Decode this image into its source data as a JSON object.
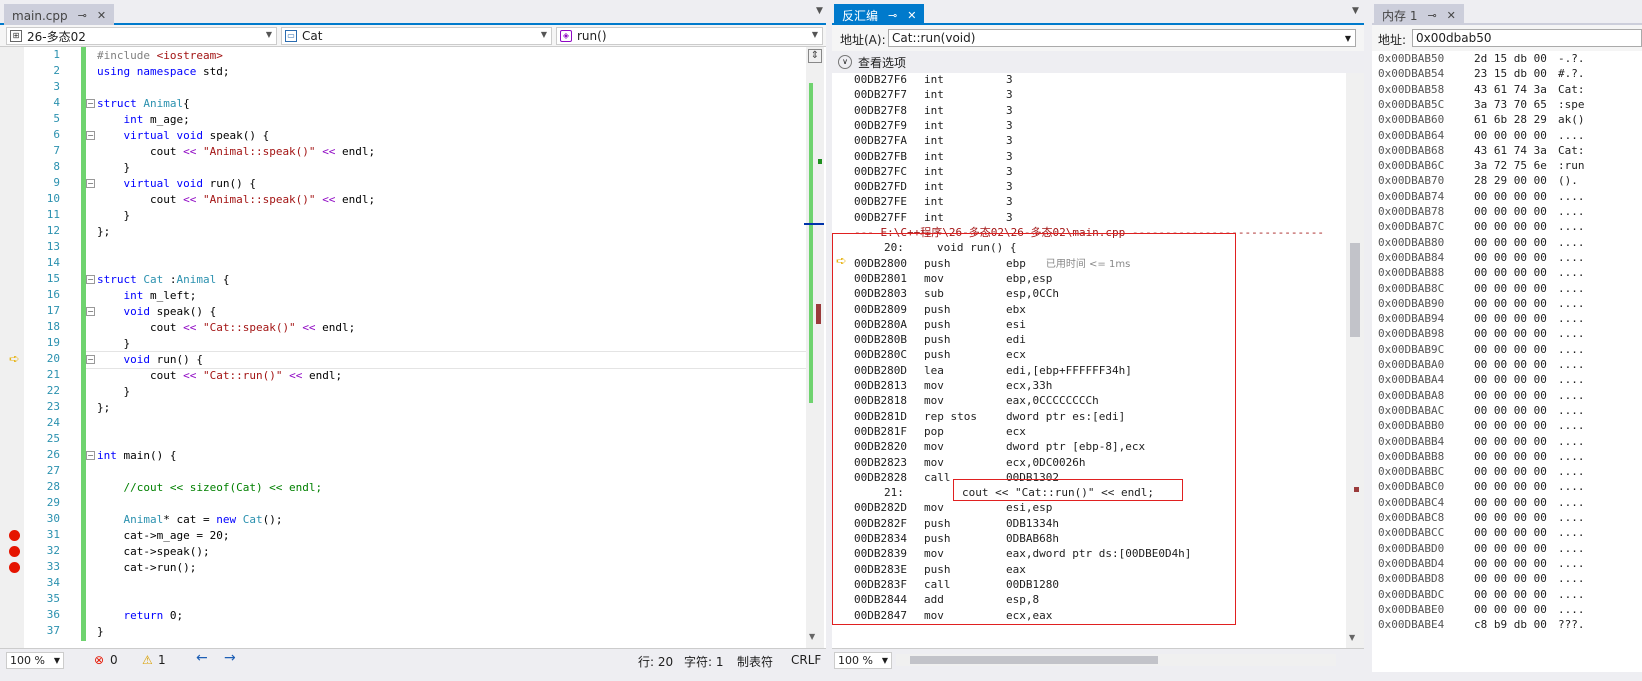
{
  "editor": {
    "tab_title": "main.cpp",
    "nav_project": "26-多态02",
    "nav_class": "Cat",
    "nav_member": "run()",
    "lines": [
      {
        "n": 1,
        "code": "#include <iostream>"
      },
      {
        "n": 2,
        "code": "using namespace std;"
      },
      {
        "n": 3,
        "code": ""
      },
      {
        "n": 4,
        "code": "struct Animal{"
      },
      {
        "n": 5,
        "code": "    int m_age;"
      },
      {
        "n": 6,
        "code": "    virtual void speak() {"
      },
      {
        "n": 7,
        "code": "        cout << \"Animal::speak()\" << endl;"
      },
      {
        "n": 8,
        "code": "    }"
      },
      {
        "n": 9,
        "code": "    virtual void run() {"
      },
      {
        "n": 10,
        "code": "        cout << \"Animal::speak()\" << endl;"
      },
      {
        "n": 11,
        "code": "    }"
      },
      {
        "n": 12,
        "code": "};"
      },
      {
        "n": 13,
        "code": ""
      },
      {
        "n": 14,
        "code": ""
      },
      {
        "n": 15,
        "code": "struct Cat :Animal {"
      },
      {
        "n": 16,
        "code": "    int m_left;"
      },
      {
        "n": 17,
        "code": "    void speak() {"
      },
      {
        "n": 18,
        "code": "        cout << \"Cat::speak()\" << endl;"
      },
      {
        "n": 19,
        "code": "    }"
      },
      {
        "n": 20,
        "code": "    void run() {"
      },
      {
        "n": 21,
        "code": "        cout << \"Cat::run()\" << endl;"
      },
      {
        "n": 22,
        "code": "    }"
      },
      {
        "n": 23,
        "code": "};"
      },
      {
        "n": 24,
        "code": ""
      },
      {
        "n": 25,
        "code": ""
      },
      {
        "n": 26,
        "code": "int main() {"
      },
      {
        "n": 27,
        "code": ""
      },
      {
        "n": 28,
        "code": "    //cout << sizeof(Cat) << endl;"
      },
      {
        "n": 29,
        "code": ""
      },
      {
        "n": 30,
        "code": "    Animal* cat = new Cat();"
      },
      {
        "n": 31,
        "code": "    cat->m_age = 20;"
      },
      {
        "n": 32,
        "code": "    cat->speak();"
      },
      {
        "n": 33,
        "code": "    cat->run();"
      },
      {
        "n": 34,
        "code": ""
      },
      {
        "n": 35,
        "code": ""
      },
      {
        "n": 36,
        "code": "    return 0;"
      },
      {
        "n": 37,
        "code": "}"
      }
    ],
    "breakpoint_lines": [
      31,
      32,
      33
    ],
    "current_line": 20,
    "fold_lines": [
      4,
      6,
      9,
      15,
      17,
      20,
      26
    ],
    "status": {
      "zoom": "100 %",
      "errors": "0",
      "warnings": "1",
      "line": "行: 20",
      "char": "字符: 1",
      "tabs": "制表符",
      "eol": "CRLF"
    }
  },
  "disasm": {
    "tab_title": "反汇编",
    "address_label": "地址(A):",
    "address_value": "Cat::run(void)",
    "view_options": "查看选项",
    "zoom": "100 %",
    "rows": [
      {
        "t": "i",
        "a": "00DB27F6",
        "op": "int",
        "arg": "3"
      },
      {
        "t": "i",
        "a": "00DB27F7",
        "op": "int",
        "arg": "3"
      },
      {
        "t": "i",
        "a": "00DB27F8",
        "op": "int",
        "arg": "3"
      },
      {
        "t": "i",
        "a": "00DB27F9",
        "op": "int",
        "arg": "3"
      },
      {
        "t": "i",
        "a": "00DB27FA",
        "op": "int",
        "arg": "3"
      },
      {
        "t": "i",
        "a": "00DB27FB",
        "op": "int",
        "arg": "3"
      },
      {
        "t": "i",
        "a": "00DB27FC",
        "op": "int",
        "arg": "3"
      },
      {
        "t": "i",
        "a": "00DB27FD",
        "op": "int",
        "arg": "3"
      },
      {
        "t": "i",
        "a": "00DB27FE",
        "op": "int",
        "arg": "3"
      },
      {
        "t": "i",
        "a": "00DB27FF",
        "op": "int",
        "arg": "3"
      },
      {
        "t": "f",
        "text": "--- E:\\C++程序\\26-多态02\\26-多态02\\main.cpp -----------------------------"
      },
      {
        "t": "s",
        "text": "20:     void run() {"
      },
      {
        "t": "i",
        "a": "00DB2800",
        "op": "push",
        "arg": "ebp",
        "hint": "已用时间 <= 1ms"
      },
      {
        "t": "i",
        "a": "00DB2801",
        "op": "mov",
        "arg": "ebp,esp"
      },
      {
        "t": "i",
        "a": "00DB2803",
        "op": "sub",
        "arg": "esp,0CCh"
      },
      {
        "t": "i",
        "a": "00DB2809",
        "op": "push",
        "arg": "ebx"
      },
      {
        "t": "i",
        "a": "00DB280A",
        "op": "push",
        "arg": "esi"
      },
      {
        "t": "i",
        "a": "00DB280B",
        "op": "push",
        "arg": "edi"
      },
      {
        "t": "i",
        "a": "00DB280C",
        "op": "push",
        "arg": "ecx"
      },
      {
        "t": "i",
        "a": "00DB280D",
        "op": "lea",
        "arg": "edi,[ebp+FFFFFF34h]"
      },
      {
        "t": "i",
        "a": "00DB2813",
        "op": "mov",
        "arg": "ecx,33h"
      },
      {
        "t": "i",
        "a": "00DB2818",
        "op": "mov",
        "arg": "eax,0CCCCCCCCh"
      },
      {
        "t": "i",
        "a": "00DB281D",
        "op": "rep stos",
        "arg": "dword ptr es:[edi]"
      },
      {
        "t": "i",
        "a": "00DB281F",
        "op": "pop",
        "arg": "ecx"
      },
      {
        "t": "i",
        "a": "00DB2820",
        "op": "mov",
        "arg": "dword ptr [ebp-8],ecx"
      },
      {
        "t": "i",
        "a": "00DB2823",
        "op": "mov",
        "arg": "ecx,0DC0026h"
      },
      {
        "t": "i",
        "a": "00DB2828",
        "op": "call",
        "arg": "00DB1302"
      },
      {
        "t": "s",
        "text": "21:",
        "extra": "cout << \"Cat::run()\" << endl;"
      },
      {
        "t": "i",
        "a": "00DB282D",
        "op": "mov",
        "arg": "esi,esp"
      },
      {
        "t": "i",
        "a": "00DB282F",
        "op": "push",
        "arg": "0DB1334h"
      },
      {
        "t": "i",
        "a": "00DB2834",
        "op": "push",
        "arg": "0DBAB68h"
      },
      {
        "t": "i",
        "a": "00DB2839",
        "op": "mov",
        "arg": "eax,dword ptr ds:[00DBE0D4h]"
      },
      {
        "t": "i",
        "a": "00DB283E",
        "op": "push",
        "arg": "eax"
      },
      {
        "t": "i",
        "a": "00DB283F",
        "op": "call",
        "arg": "00DB1280"
      },
      {
        "t": "i",
        "a": "00DB2844",
        "op": "add",
        "arg": "esp,8"
      },
      {
        "t": "i",
        "a": "00DB2847",
        "op": "mov",
        "arg": "ecx,eax"
      }
    ]
  },
  "memory": {
    "tab_title": "内存 1",
    "address_label": "地址:",
    "address_value": "0x00dbab50",
    "rows": [
      {
        "a": "0x00DBAB50",
        "b": "2d 15 db 00",
        "c": "-.?."
      },
      {
        "a": "0x00DBAB54",
        "b": "23 15 db 00",
        "c": "#.?."
      },
      {
        "a": "0x00DBAB58",
        "b": "43 61 74 3a",
        "c": "Cat:"
      },
      {
        "a": "0x00DBAB5C",
        "b": "3a 73 70 65",
        "c": ":spe"
      },
      {
        "a": "0x00DBAB60",
        "b": "61 6b 28 29",
        "c": "ak()"
      },
      {
        "a": "0x00DBAB64",
        "b": "00 00 00 00",
        "c": "...."
      },
      {
        "a": "0x00DBAB68",
        "b": "43 61 74 3a",
        "c": "Cat:"
      },
      {
        "a": "0x00DBAB6C",
        "b": "3a 72 75 6e",
        "c": ":run"
      },
      {
        "a": "0x00DBAB70",
        "b": "28 29 00 00",
        "c": "()."
      },
      {
        "a": "0x00DBAB74",
        "b": "00 00 00 00",
        "c": "...."
      },
      {
        "a": "0x00DBAB78",
        "b": "00 00 00 00",
        "c": "...."
      },
      {
        "a": "0x00DBAB7C",
        "b": "00 00 00 00",
        "c": "...."
      },
      {
        "a": "0x00DBAB80",
        "b": "00 00 00 00",
        "c": "...."
      },
      {
        "a": "0x00DBAB84",
        "b": "00 00 00 00",
        "c": "...."
      },
      {
        "a": "0x00DBAB88",
        "b": "00 00 00 00",
        "c": "...."
      },
      {
        "a": "0x00DBAB8C",
        "b": "00 00 00 00",
        "c": "...."
      },
      {
        "a": "0x00DBAB90",
        "b": "00 00 00 00",
        "c": "...."
      },
      {
        "a": "0x00DBAB94",
        "b": "00 00 00 00",
        "c": "...."
      },
      {
        "a": "0x00DBAB98",
        "b": "00 00 00 00",
        "c": "...."
      },
      {
        "a": "0x00DBAB9C",
        "b": "00 00 00 00",
        "c": "...."
      },
      {
        "a": "0x00DBABA0",
        "b": "00 00 00 00",
        "c": "...."
      },
      {
        "a": "0x00DBABA4",
        "b": "00 00 00 00",
        "c": "...."
      },
      {
        "a": "0x00DBABA8",
        "b": "00 00 00 00",
        "c": "...."
      },
      {
        "a": "0x00DBABAC",
        "b": "00 00 00 00",
        "c": "...."
      },
      {
        "a": "0x00DBABB0",
        "b": "00 00 00 00",
        "c": "...."
      },
      {
        "a": "0x00DBABB4",
        "b": "00 00 00 00",
        "c": "...."
      },
      {
        "a": "0x00DBABB8",
        "b": "00 00 00 00",
        "c": "...."
      },
      {
        "a": "0x00DBABBC",
        "b": "00 00 00 00",
        "c": "...."
      },
      {
        "a": "0x00DBABC0",
        "b": "00 00 00 00",
        "c": "...."
      },
      {
        "a": "0x00DBABC4",
        "b": "00 00 00 00",
        "c": "...."
      },
      {
        "a": "0x00DBABC8",
        "b": "00 00 00 00",
        "c": "...."
      },
      {
        "a": "0x00DBABCC",
        "b": "00 00 00 00",
        "c": "...."
      },
      {
        "a": "0x00DBABD0",
        "b": "00 00 00 00",
        "c": "...."
      },
      {
        "a": "0x00DBABD4",
        "b": "00 00 00 00",
        "c": "...."
      },
      {
        "a": "0x00DBABD8",
        "b": "00 00 00 00",
        "c": "...."
      },
      {
        "a": "0x00DBABDC",
        "b": "00 00 00 00",
        "c": "...."
      },
      {
        "a": "0x00DBABE0",
        "b": "00 00 00 00",
        "c": "...."
      },
      {
        "a": "0x00DBABE4",
        "b": "c8 b9 db 00",
        "c": "???."
      }
    ]
  },
  "colors": {
    "accent": "#007acc",
    "breakpoint": "#e51400",
    "change_bar": "#6fd36f",
    "highlight_box": "#e02020"
  }
}
